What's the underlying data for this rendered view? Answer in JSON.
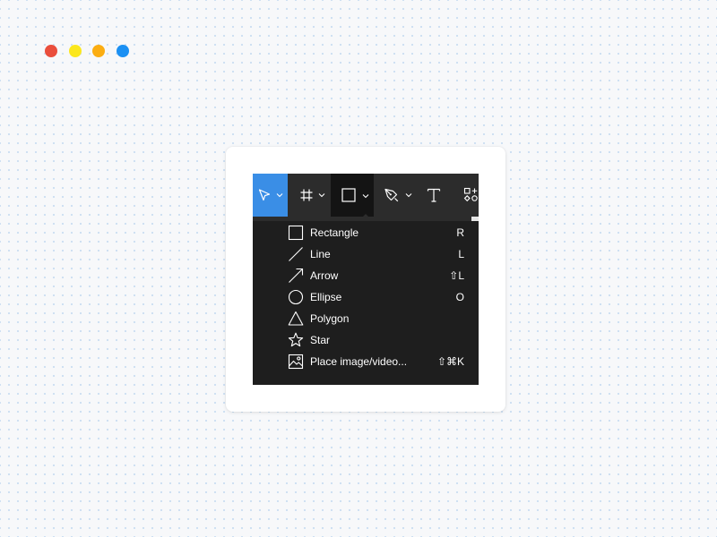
{
  "window_controls": [
    {
      "name": "red-dot",
      "color": "#ea4e3c"
    },
    {
      "name": "yellow-dot",
      "color": "#fbe71d"
    },
    {
      "name": "orange-dot",
      "color": "#fbad12"
    },
    {
      "name": "blue-dot",
      "color": "#1b90f3"
    }
  ],
  "toolbar": {
    "tools": [
      {
        "name": "move-tool",
        "icon": "cursor-arrow-icon",
        "has_dropdown": true,
        "active": true
      },
      {
        "name": "frame-tool",
        "icon": "frame-hash-icon",
        "has_dropdown": true
      },
      {
        "name": "shape-tool",
        "icon": "square-icon",
        "has_dropdown": true,
        "open": true
      },
      {
        "name": "pen-tool",
        "icon": "pen-nib-icon",
        "has_dropdown": true
      },
      {
        "name": "text-tool",
        "icon": "text-t-icon",
        "has_dropdown": false
      },
      {
        "name": "components-tool",
        "icon": "components-icon",
        "has_dropdown": false
      }
    ],
    "active_color": "#3a8ee6",
    "open_color": "#141414",
    "bar_color": "#2c2c2c"
  },
  "shape_menu": {
    "items": [
      {
        "label": "Rectangle",
        "shortcut": "R",
        "icon": "rectangle-icon"
      },
      {
        "label": "Line",
        "shortcut": "L",
        "icon": "line-icon"
      },
      {
        "label": "Arrow",
        "shortcut": "⇧L",
        "icon": "arrow-icon"
      },
      {
        "label": "Ellipse",
        "shortcut": "O",
        "icon": "ellipse-icon"
      },
      {
        "label": "Polygon",
        "shortcut": "",
        "icon": "polygon-icon"
      },
      {
        "label": "Star",
        "shortcut": "",
        "icon": "star-icon"
      },
      {
        "label": "Place image/video...",
        "shortcut": "⇧⌘K",
        "icon": "image-icon"
      }
    ],
    "background": "#1e1e1e"
  }
}
